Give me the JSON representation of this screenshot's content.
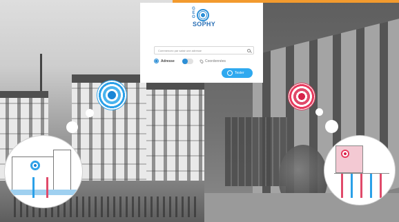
{
  "logo": {
    "letters": [
      "G",
      "E",
      "O"
    ],
    "word": "SOPHY"
  },
  "search": {
    "placeholder": "Commencez par saisir une adresse",
    "icon": "search-icon"
  },
  "mode": {
    "address_label": "Adresse",
    "coordinates_label": "Coordonnées",
    "selected": "Adresse"
  },
  "submit": {
    "label": "Tester",
    "icon": "check-circle-icon"
  },
  "colors": {
    "accent_blue": "#2fa9ef",
    "marker_red": "#e83a5e",
    "top_strip": "#f29a2e"
  }
}
